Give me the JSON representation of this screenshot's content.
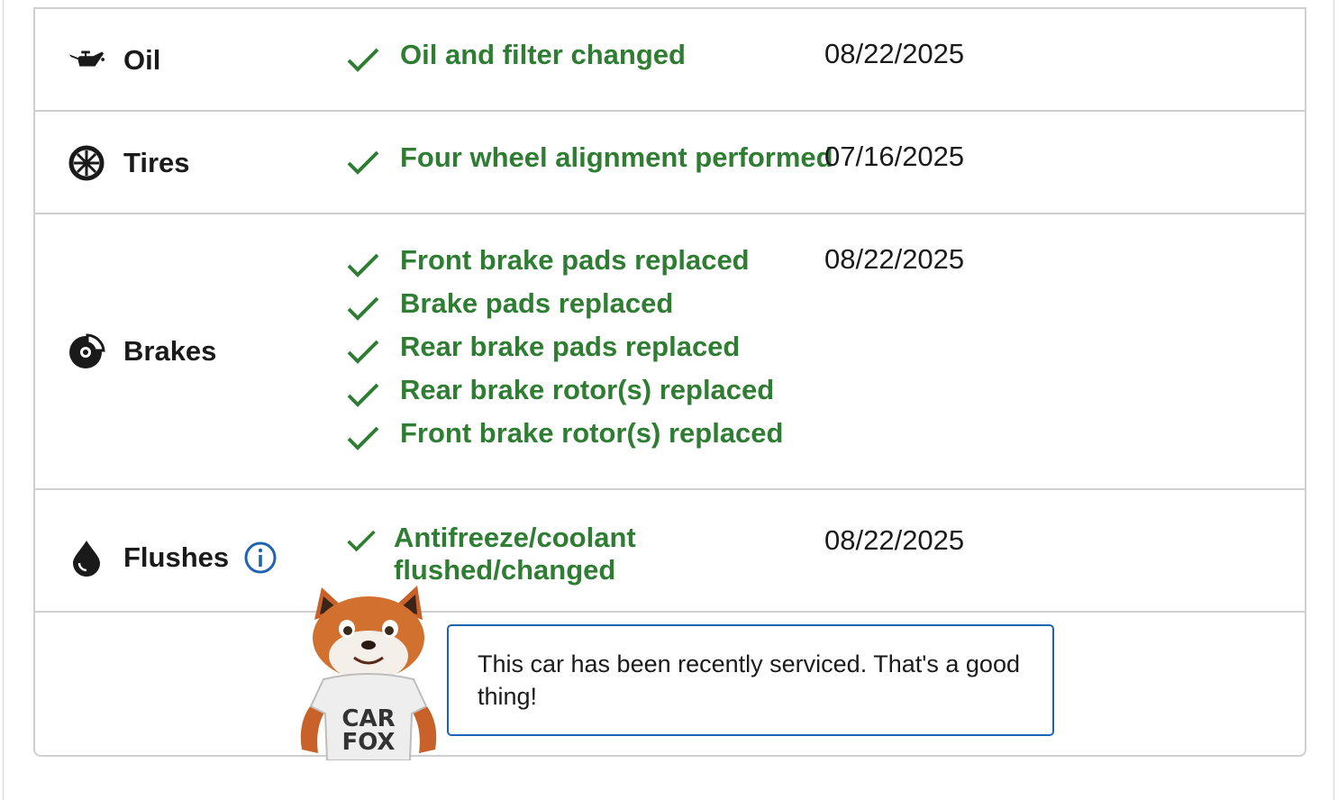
{
  "services": [
    {
      "category": "Oil",
      "icon": "oil-can-icon",
      "items": [
        "Oil and filter changed"
      ],
      "date": "08/22/2025"
    },
    {
      "category": "Tires",
      "icon": "tire-icon",
      "items": [
        "Four wheel alignment performed"
      ],
      "date": "07/16/2025"
    },
    {
      "category": "Brakes",
      "icon": "brake-disc-icon",
      "items": [
        "Front brake pads replaced",
        "Brake pads replaced",
        "Rear brake pads replaced",
        "Rear brake rotor(s) replaced",
        "Front brake rotor(s) replaced"
      ],
      "date": "08/22/2025"
    },
    {
      "category": "Flushes",
      "icon": "drop-icon",
      "items": [
        "Antifreeze/coolant flushed/changed"
      ],
      "date": "08/22/2025"
    }
  ],
  "mascot": {
    "shirt_line1": "CAR",
    "shirt_line2": "FOX"
  },
  "summary": {
    "message": "This car has been recently serviced. That's a good thing!"
  },
  "colors": {
    "check_green": "#2e7d32",
    "info_blue": "#1e64b4",
    "border": "#cfcfcf"
  }
}
